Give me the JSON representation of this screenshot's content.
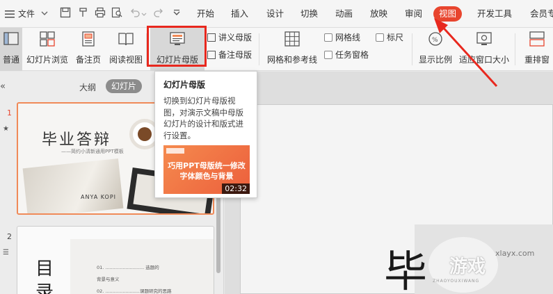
{
  "menubar": {
    "file_label": "文件",
    "tabs": [
      "开始",
      "插入",
      "设计",
      "切换",
      "动画",
      "放映",
      "审阅",
      "视图",
      "开发工具",
      "会员专"
    ],
    "active_tab": "视图"
  },
  "ribbon": {
    "normal": "普通",
    "slide_sorter": "幻灯片浏览",
    "notes_page": "备注页",
    "reading_view": "阅读视图",
    "slide_master": "幻灯片母版",
    "handout_master": "讲义母版",
    "notes_master": "备注母版",
    "grid_guides": "网格和参考线",
    "gridlines": "网格线",
    "ruler": "标尺",
    "task_pane": "任务窗格",
    "zoom": "显示比例",
    "fit_window": "适应窗口大小",
    "rearrange": "重排窗"
  },
  "leftpanel": {
    "outline_tab": "大纲",
    "slides_tab": "幻灯片",
    "collapse": "«",
    "slide1_num": "1",
    "slide2_num": "2",
    "slide1_title": "毕业答辩",
    "slide1_subtitle": "——简约小清新通用PPT模板",
    "slide1_footer": "ANYA KOPI",
    "slide2_title_a": "目",
    "slide2_title_b": "录",
    "slide2_item1": "01. ........................... 选题的",
    "slide2_item1b": "背景与意义",
    "slide2_item2": "02. ........................课题研究的思路"
  },
  "tooltip": {
    "title": "幻灯片母版",
    "body": "切换到幻灯片母版视图，对演示文稿中母版幻灯片的设计和版式进行设置。",
    "video_title": "巧用PPT母版统一修改字体颜色与背景",
    "video_duration": "02:32"
  },
  "canvas": {
    "big_char": "毕",
    "watermark": "xlayx.com",
    "watermark_brand": "游戏",
    "watermark_sub": "ZHAOYOUXIWANG"
  },
  "colors": {
    "accent": "#e8452e",
    "highlight": "#e8281e",
    "arrow": "#e8281e"
  }
}
